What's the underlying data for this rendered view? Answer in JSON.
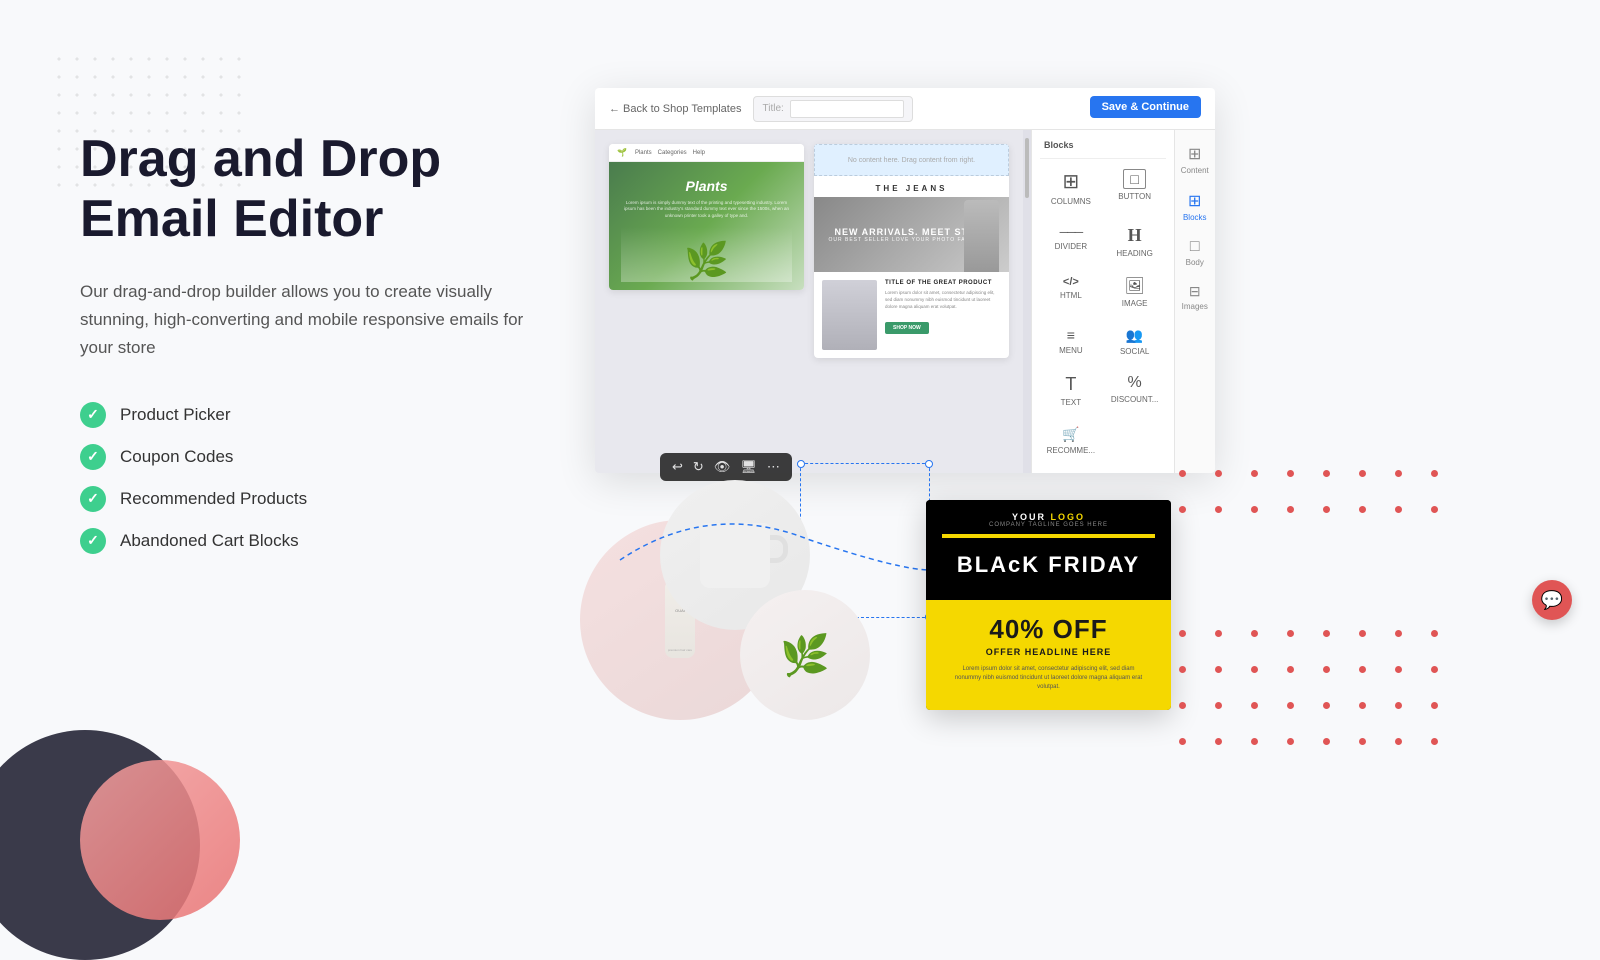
{
  "page": {
    "background": "#f8f9fb"
  },
  "hero": {
    "heading_line1": "Drag and Drop",
    "heading_line2": "Email Editor",
    "subtext": "Our drag-and-drop builder allows you to create visually stunning, high-converting and mobile responsive emails for your store",
    "features": [
      {
        "label": "Product Picker"
      },
      {
        "label": "Coupon Codes"
      },
      {
        "label": "Recommended Products"
      },
      {
        "label": "Abandoned Cart Blocks"
      }
    ]
  },
  "editor": {
    "back_label": "← Back to Shop Templates",
    "title_label": "Title:",
    "save_button": "Save & Continue"
  },
  "right_panel": {
    "tabs": [
      {
        "label": "Content",
        "icon": "⊞"
      },
      {
        "label": "Blocks",
        "icon": "⊞"
      },
      {
        "label": "Body",
        "icon": "□"
      },
      {
        "label": "Images",
        "icon": "⊟"
      }
    ],
    "blocks": [
      {
        "label": "COLUMNS",
        "icon": "⊞"
      },
      {
        "label": "BUTTON",
        "icon": "□"
      },
      {
        "label": "DIVIDER",
        "icon": "─"
      },
      {
        "label": "HEADING",
        "icon": "H"
      },
      {
        "label": "HTML",
        "icon": "</>"
      },
      {
        "label": "IMAGE",
        "icon": "🖼"
      },
      {
        "label": "MENU",
        "icon": "≡"
      },
      {
        "label": "SOCIAL",
        "icon": "👥"
      },
      {
        "label": "TEXT",
        "icon": "T"
      },
      {
        "label": "DISCOUNT...",
        "icon": "%"
      },
      {
        "label": "RECOMME...",
        "icon": "🛒"
      }
    ]
  },
  "plants_template": {
    "nav_logo": "🌱",
    "nav_links": [
      "Plants",
      "Categories",
      "Help"
    ],
    "hero_title": "Plants",
    "hero_desc": "Lorem ipsum is simply dummy text of the printing and typesetting industry. Lorem ipsum has been the industry standard dummy text ever since the 1500s, when an unknown printer took a gallery of type and.",
    "bg_color": "#4a7c4e"
  },
  "jeans_template": {
    "empty_content": "No content here. Drag content from right.",
    "brand": "THE JEANS",
    "headline": "NEW ARRIVALS. MEET STYLE",
    "sub": "OUR BEST SELLER LOVE YOUR PHOTO FAVOURITE",
    "product_title": "TITLE OF THE GREAT PRODUCT",
    "product_desc": "Lorem ipsum dolor sit amet, consectetur adipiscing elit, sed diam nonummy nibh euismod tincidunt ut laoreet dolore magna aliquam erat volutpat.",
    "cta": "SHOP NOW"
  },
  "toolbar": {
    "buttons": [
      "↩",
      "↻",
      "👁",
      "□",
      "⋯"
    ]
  },
  "bf_email": {
    "logo": "YOUR LOGO",
    "logo_accent": "LOGO",
    "tagline": "COMPANY TAGLINE GOES HERE",
    "title": "BLAcK FRIDAY",
    "discount": "40% OFF",
    "offer_headline": "OFFER HEADLINE HERE",
    "body_text": "Lorem ipsum dolor sit amet, consectetur adipiscing elit, sed diam nonummy nibh euismod tincidunt ut laoreet dolore magna aliquam erat volutpat."
  },
  "products": {
    "circle1_label": "bottle",
    "circle2_label": "mug",
    "circle3_label": "plant"
  }
}
